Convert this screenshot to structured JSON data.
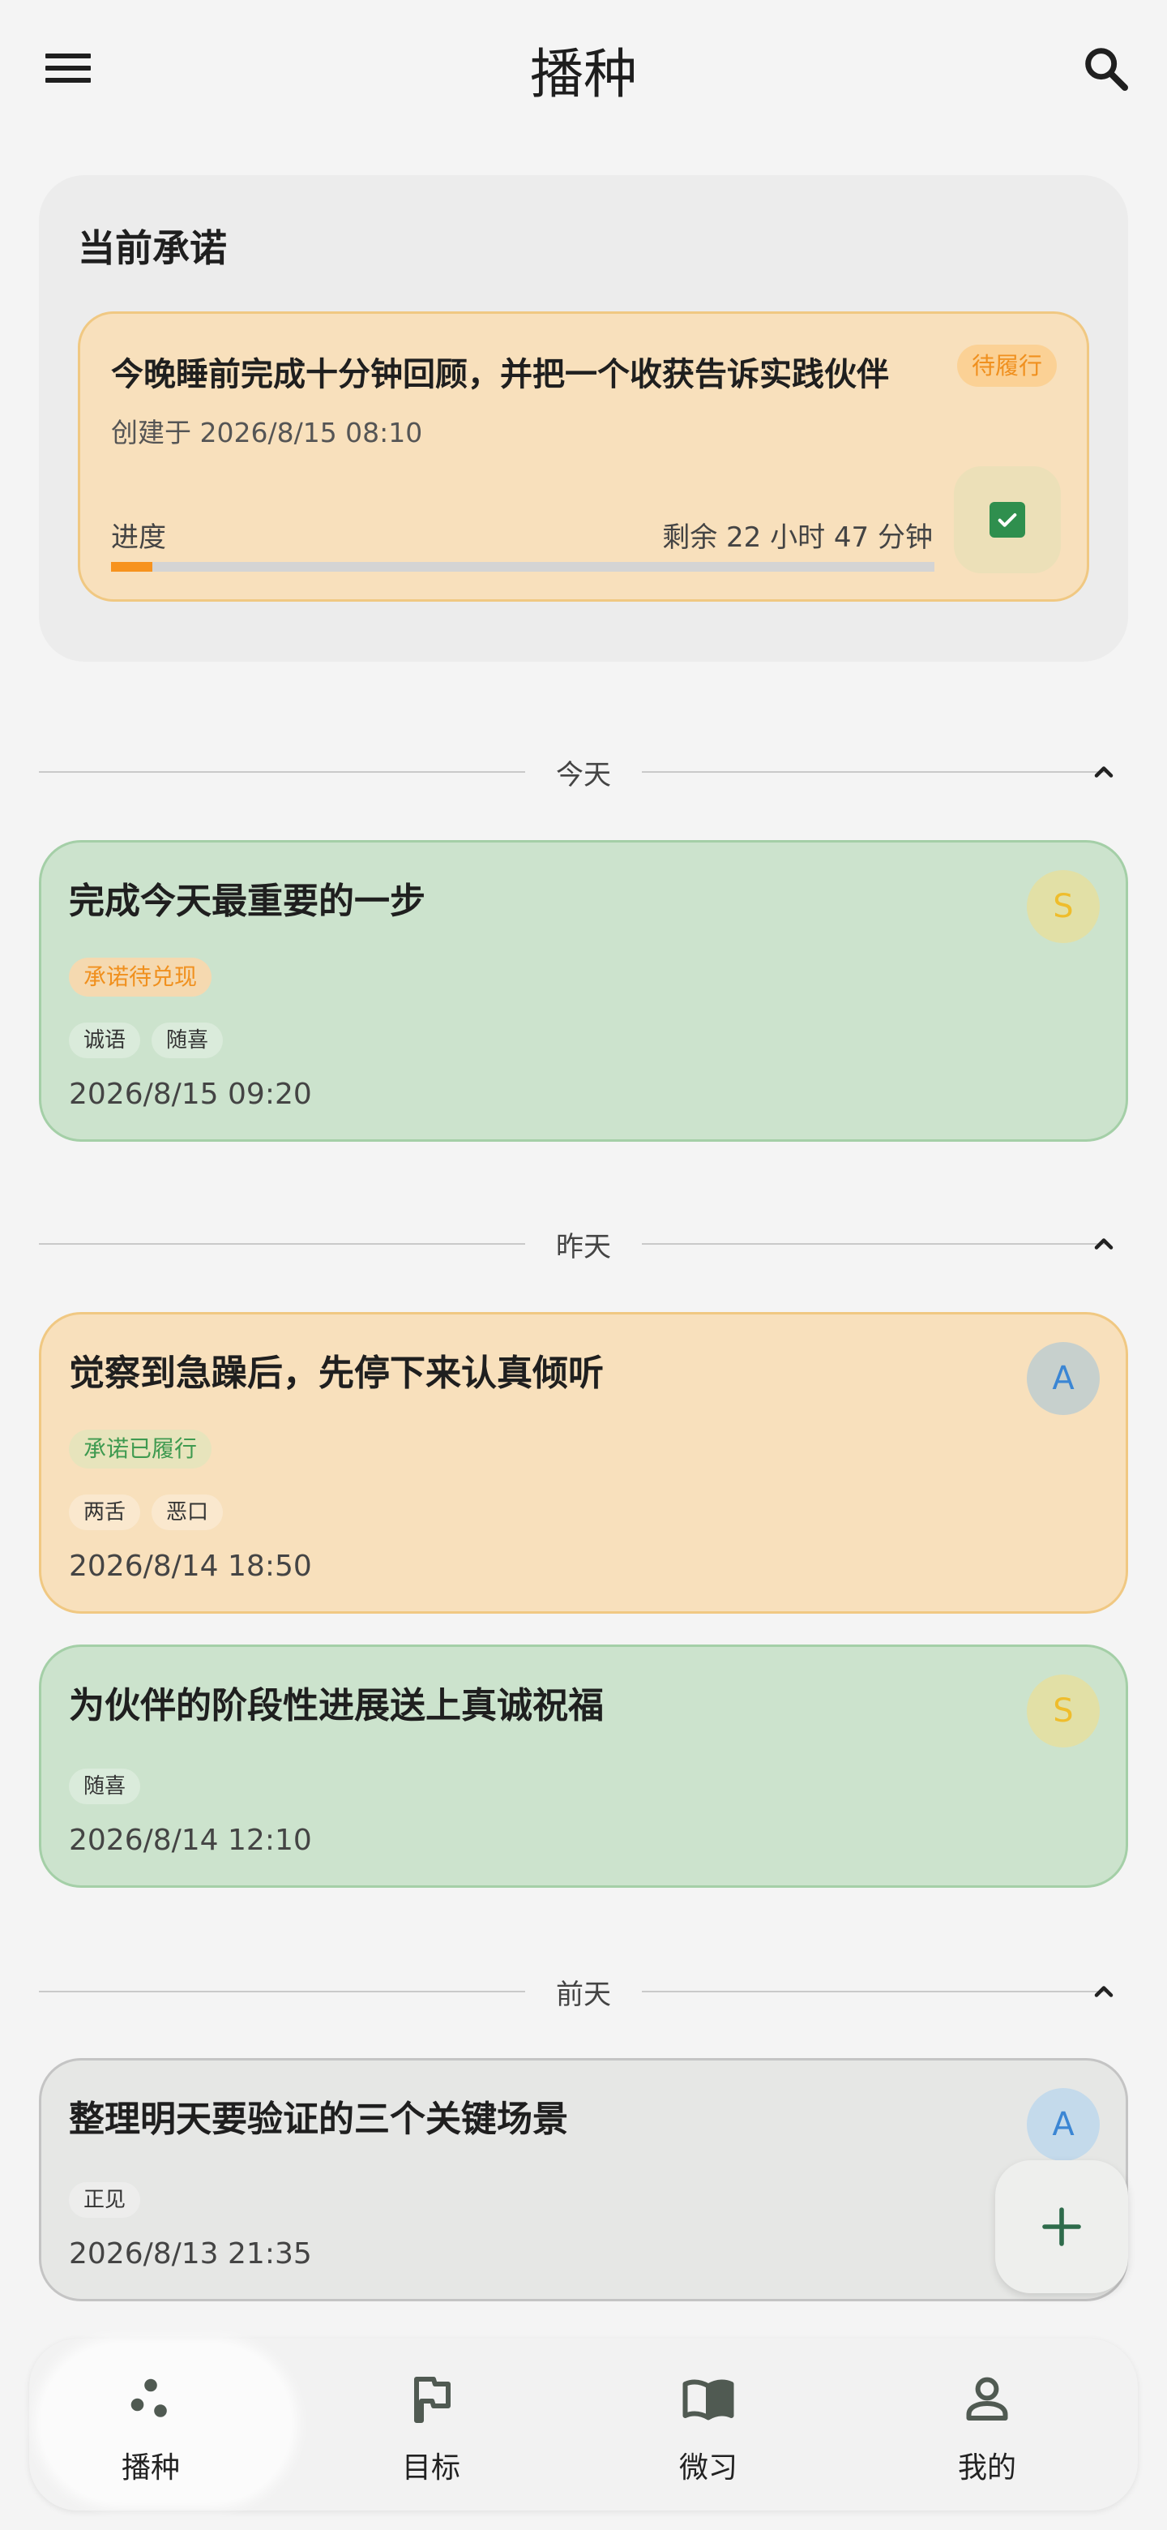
{
  "app": {
    "title": "播种"
  },
  "commitment": {
    "heading": "当前承诺",
    "title": "今晚睡前完成十分钟回顾，并把一个收获告诉实践伙伴",
    "badge": "待履行",
    "created": "创建于 2026/8/15 08:10",
    "progress_label": "进度",
    "remaining": "剩余 22 小时 47 分钟",
    "progress": 0.05
  },
  "sections": [
    {
      "label": "今天"
    },
    {
      "label": "昨天"
    },
    {
      "label": "前天"
    }
  ],
  "cards": [
    {
      "title": "完成今天最重要的一步",
      "avatar": "S",
      "status": "承诺待兑现",
      "tags": [
        "诚语",
        "随喜"
      ],
      "date": "2026/8/15 09:20"
    },
    {
      "title": "觉察到急躁后，先停下来认真倾听",
      "avatar": "A",
      "status": "承诺已履行",
      "tags": [
        "两舌",
        "恶口"
      ],
      "date": "2026/8/14 18:50"
    },
    {
      "title": "为伙伴的阶段性进展送上真诚祝福",
      "avatar": "S",
      "tags": [
        "随喜"
      ],
      "date": "2026/8/14 12:10"
    },
    {
      "title": "整理明天要验证的三个关键场景",
      "avatar": "A",
      "tags": [
        "正见"
      ],
      "date": "2026/8/13 21:35"
    }
  ],
  "nav": [
    {
      "label": "播种",
      "icon": "seeds-icon",
      "active": true
    },
    {
      "label": "目标",
      "icon": "flag-icon"
    },
    {
      "label": "微习",
      "icon": "book-icon"
    },
    {
      "label": "我的",
      "icon": "person-icon"
    }
  ],
  "colors": {
    "accent": "#f7931e",
    "green_card": "#cce3cd",
    "orange_card": "#f8e0bc",
    "check": "#2f8f4e"
  }
}
